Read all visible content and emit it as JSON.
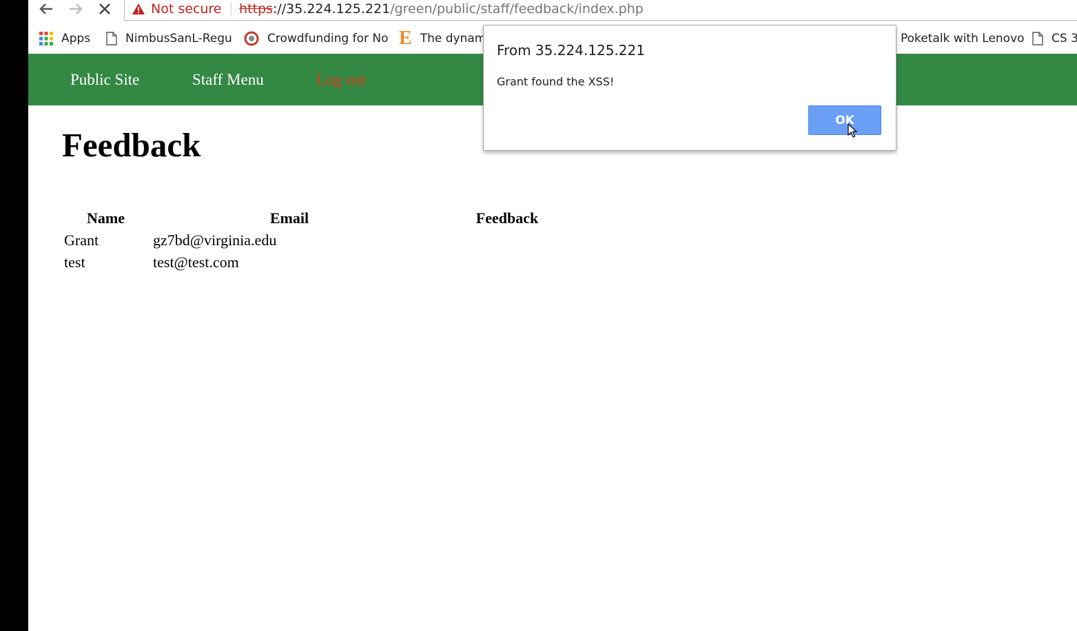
{
  "browser": {
    "security_label": "Not secure",
    "url_scheme": "https",
    "url_host": "://35.224.125.221",
    "url_path": "/green/public/staff/feedback/index.php"
  },
  "bookmarks": {
    "apps": "Apps",
    "item1": "NimbusSanL-Regu",
    "item2": "Crowdfunding for No",
    "item3": "The dynam",
    "item4": "Poketalk with Lenovo",
    "item5": "CS 3"
  },
  "site_nav": {
    "public_site": "Public Site",
    "staff_menu": "Staff Menu",
    "log_out": "Log out"
  },
  "page": {
    "title": "Feedback"
  },
  "table": {
    "headers": [
      "Name",
      "Email",
      "Feedback"
    ],
    "rows": [
      {
        "name": "Grant",
        "email": "gz7bd@virginia.edu",
        "feedback": ""
      },
      {
        "name": "test",
        "email": "test@test.com",
        "feedback": ""
      }
    ]
  },
  "dialog": {
    "title": "From 35.224.125.221",
    "message": "Grant found the XSS!",
    "ok_label": "OK"
  },
  "colors": {
    "nav_green": "#338844",
    "logout_red": "#e53b1d",
    "ok_blue": "#6a9ff5",
    "insecure_red": "#c5221f"
  },
  "icons": [
    "back-arrow-icon",
    "forward-arrow-icon",
    "stop-loading-icon",
    "warning-triangle-icon",
    "apps-grid-icon",
    "page-icon",
    "crowdfunding-logo-icon",
    "e-logo-icon",
    "mouse-cursor-icon"
  ]
}
